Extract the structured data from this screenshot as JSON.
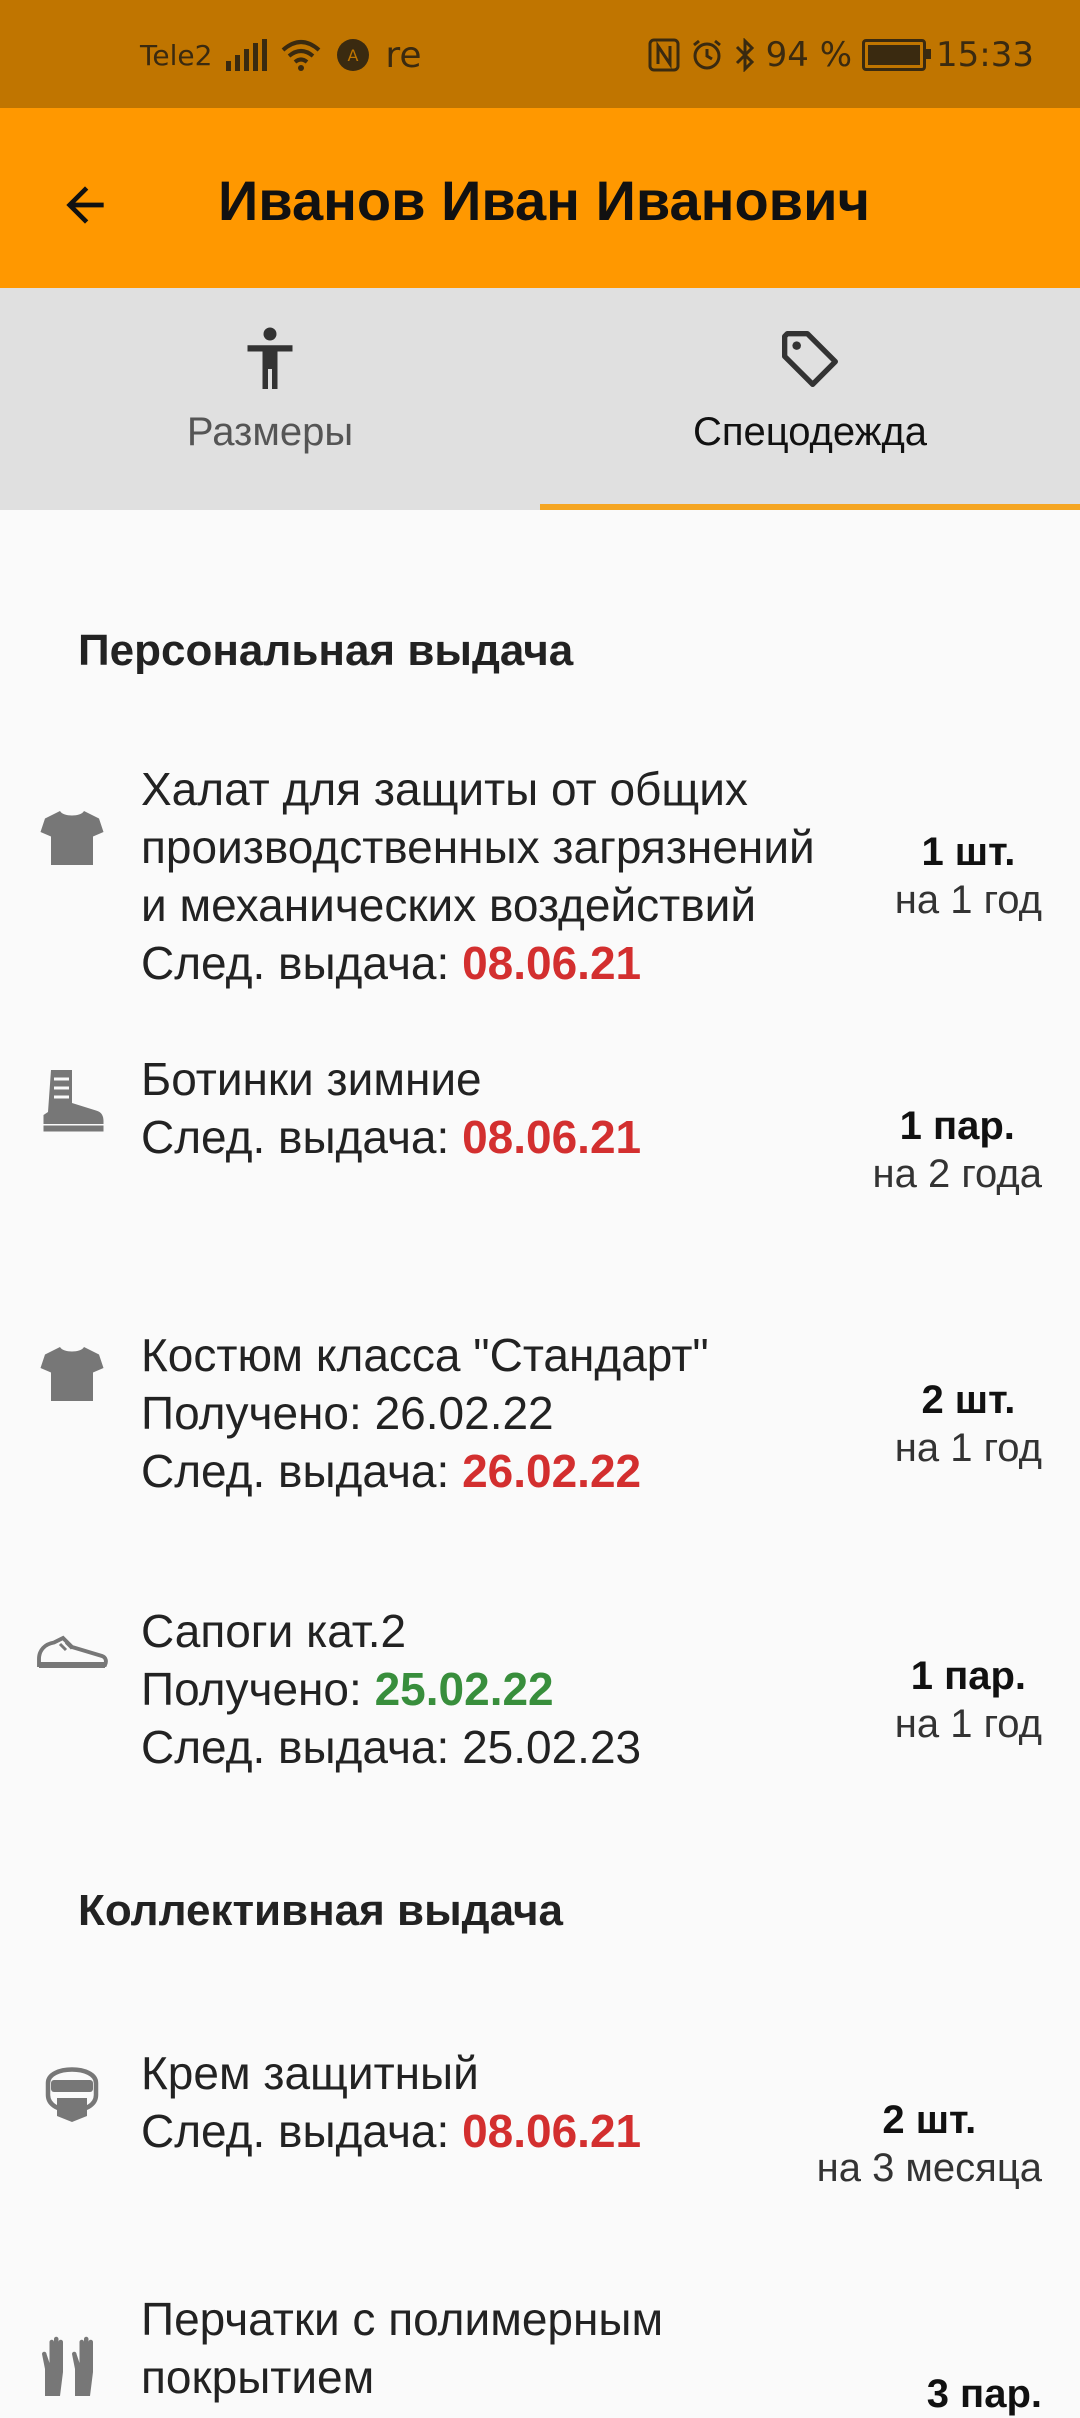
{
  "status_bar": {
    "carrier": "Tele2",
    "extra": "re",
    "battery": "94 %",
    "time": "15:33"
  },
  "app_bar": {
    "title": "Иванов Иван Иванович"
  },
  "tabs": [
    {
      "label": "Размеры",
      "icon": "person-icon",
      "active": false
    },
    {
      "label": "Спецодежда",
      "icon": "tag-icon",
      "active": true
    }
  ],
  "sections": {
    "personal": {
      "title": "Персональная выдача",
      "items": [
        {
          "icon": "tshirt-icon",
          "name_lines": [
            "Халат для защиты от общих",
            "производственных загрязнений",
            "и механических воздействий"
          ],
          "next_label": "След. выдача: ",
          "next_date": "08.06.21",
          "qty": "1 шт.",
          "period": "на 1 год"
        },
        {
          "icon": "boot-icon",
          "name": "Ботинки зимние",
          "next_label": "След. выдача: ",
          "next_date": "08.06.21",
          "qty": "1 пар.",
          "period": "на 2 года"
        },
        {
          "icon": "tshirt-icon",
          "name": "Костюм класса \"Стандарт\"",
          "received_label": "Получено: ",
          "received_date": "26.02.22",
          "next_label": "След. выдача: ",
          "next_date": "26.02.22",
          "qty": "2 шт.",
          "period": "на 1 год"
        },
        {
          "icon": "sneaker-icon",
          "name": "Сапоги кат.2",
          "received_label": "Получено: ",
          "received_date": "25.02.22",
          "next_label": "След. выдача: ",
          "next_date": "25.02.23",
          "qty": "1 пар.",
          "period": "на 1 год"
        }
      ]
    },
    "collective": {
      "title": "Коллективная выдача",
      "items": [
        {
          "icon": "face-shield-icon",
          "name": "Крем защитный",
          "next_label": "След. выдача: ",
          "next_date": "08.06.21",
          "qty": "2 шт.",
          "period": "на 3 месяца"
        },
        {
          "icon": "gloves-icon",
          "name_lines": [
            "Перчатки с полимерным",
            "покрытием"
          ],
          "qty": "3 пар."
        }
      ]
    }
  },
  "colors": {
    "status_bar": "#c07500",
    "app_bar": "#ff9800",
    "tab_bar": "#e0e0e0",
    "tab_indicator": "#f5a623",
    "overdue": "#d32f2f",
    "received": "#388e3c"
  }
}
